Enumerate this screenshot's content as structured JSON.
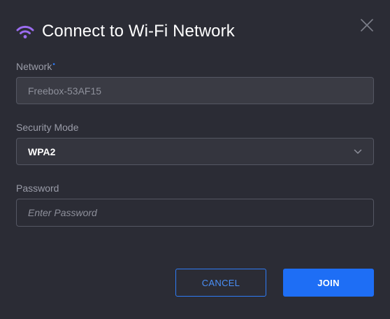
{
  "dialog": {
    "title": "Connect to Wi-Fi Network",
    "icon": "wifi-icon",
    "accent_color": "#9b6cf0"
  },
  "fields": {
    "network": {
      "label": "Network",
      "required_marker": "•",
      "value": "Freebox-53AF15"
    },
    "security": {
      "label": "Security Mode",
      "value": "WPA2"
    },
    "password": {
      "label": "Password",
      "placeholder": "Enter Password",
      "value": ""
    }
  },
  "buttons": {
    "cancel_label": "CANCEL",
    "join_label": "JOIN",
    "primary_color": "#1e6ef5"
  }
}
